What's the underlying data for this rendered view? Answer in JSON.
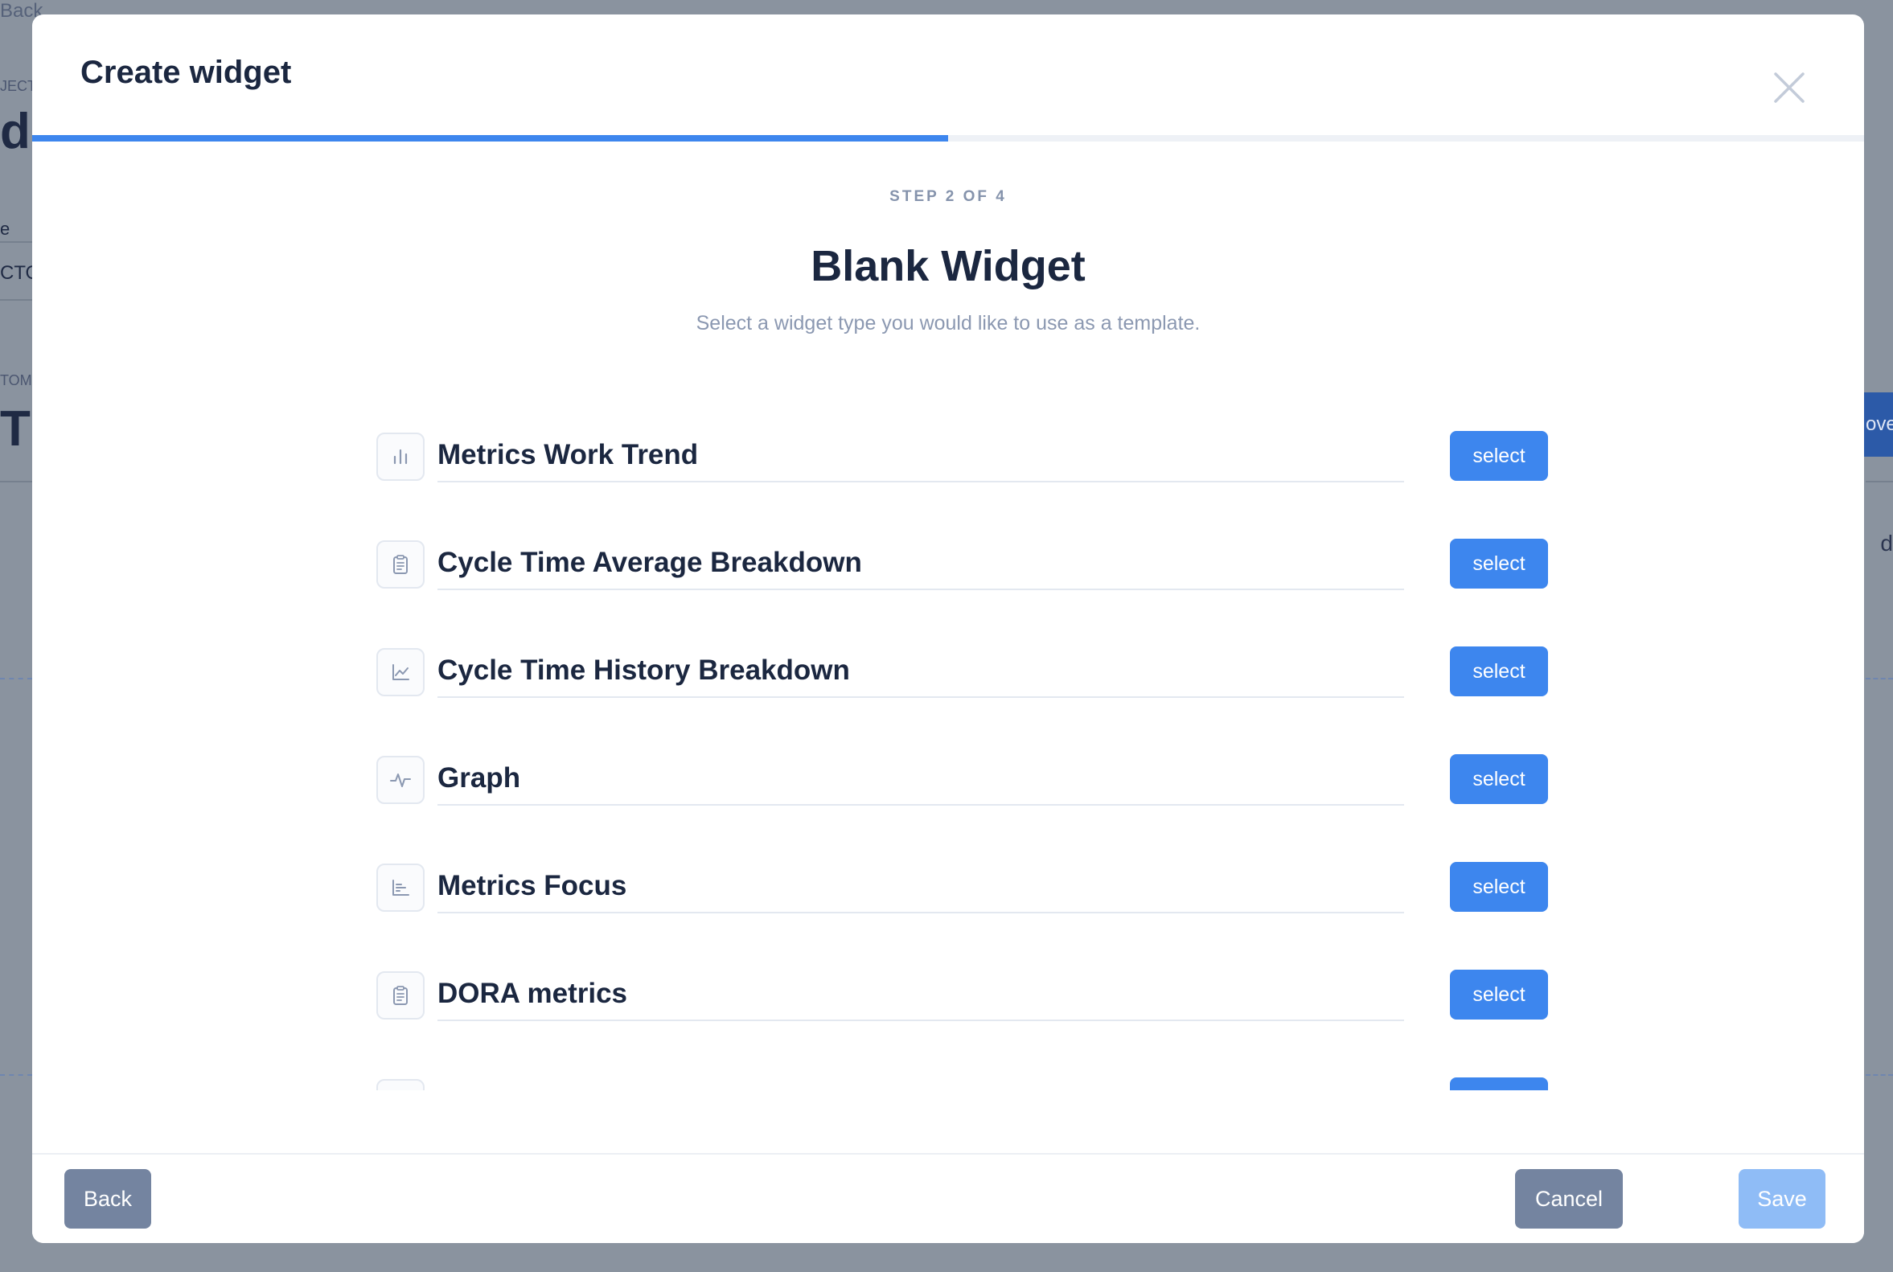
{
  "background": {
    "back_link": "Back",
    "label_1": "JECT",
    "heading_1": "di",
    "text_1": "e",
    "text_2": "CTO",
    "label_2": "TOM",
    "heading_2": "TC",
    "right_button": "ove",
    "right_text": "d"
  },
  "modal": {
    "title": "Create widget",
    "close_icon": "close-icon",
    "progress_percent": 50,
    "step_label": "STEP 2 OF 4",
    "heading": "Blank Widget",
    "subtitle": "Select a widget type you would like to use as a template.",
    "widgets": [
      {
        "title": "Metrics Work Trend",
        "icon": "bar-chart-icon",
        "button": "select"
      },
      {
        "title": "Cycle Time Average Breakdown",
        "icon": "clipboard-icon",
        "button": "select"
      },
      {
        "title": "Cycle Time History Breakdown",
        "icon": "line-chart-icon",
        "button": "select"
      },
      {
        "title": "Graph",
        "icon": "pulse-icon",
        "button": "select"
      },
      {
        "title": "Metrics Focus",
        "icon": "horizontal-bar-chart-icon",
        "button": "select"
      },
      {
        "title": "DORA metrics",
        "icon": "clipboard-icon",
        "button": "select"
      }
    ],
    "footer": {
      "back_label": "Back",
      "cancel_label": "Cancel",
      "save_label": "Save"
    }
  },
  "colors": {
    "accent": "#3d86ee",
    "overlay": "#8a939f",
    "secondary_button": "#7484a0",
    "disabled_button": "#8fbcf6",
    "title_text": "#1b2740",
    "muted_text": "#8b98b1"
  }
}
